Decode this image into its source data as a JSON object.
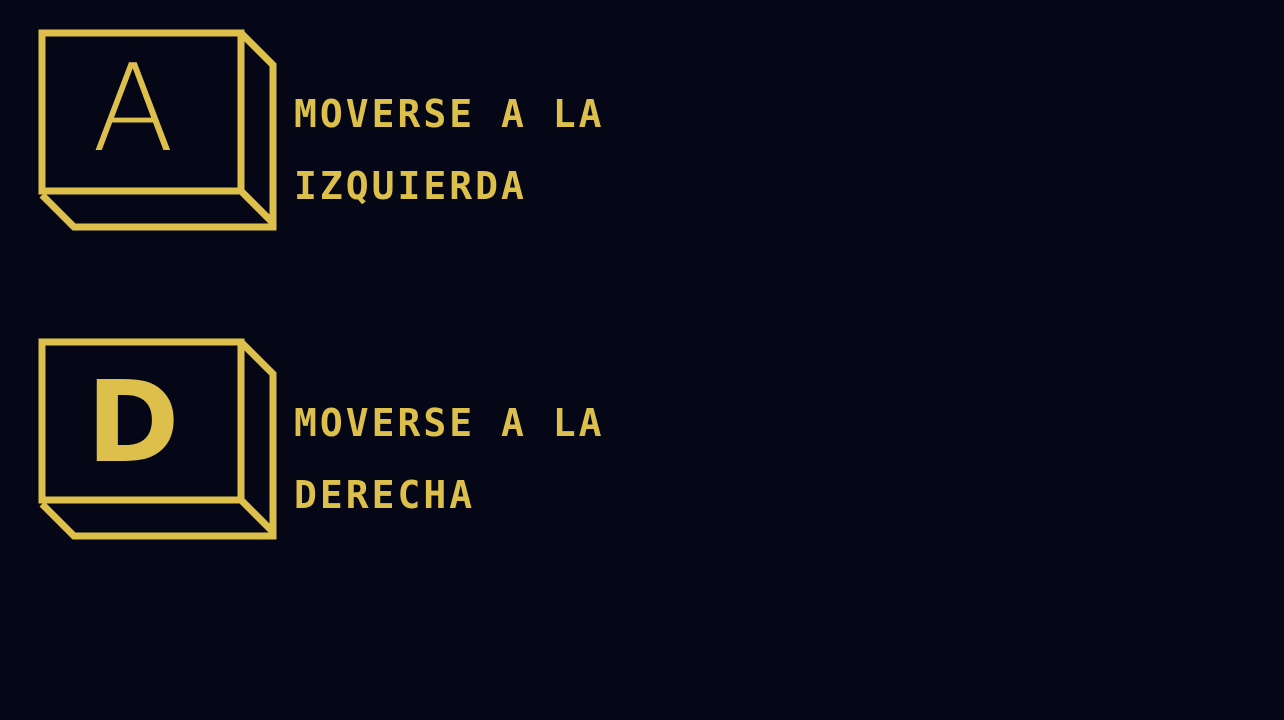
{
  "colors": {
    "background": "#050716",
    "accent": "#dcc04b"
  },
  "controls": [
    {
      "key": "A",
      "line1": "MOVERSE A LA",
      "line2": "IZQUIERDA"
    },
    {
      "key": "D",
      "line1": "MOVERSE A LA",
      "line2": "DERECHA"
    }
  ]
}
